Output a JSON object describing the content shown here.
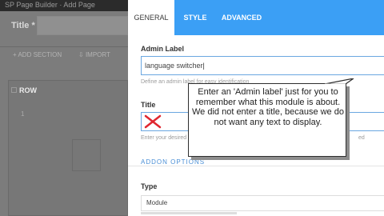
{
  "background": {
    "breadcrumb": "SP Page Builder · Add Page",
    "title_label": "Title *",
    "add_section_label": "ADD SECTION",
    "import_label": "IMPORT",
    "row_label": "ROW",
    "row_number": "1"
  },
  "modal": {
    "tabs": [
      {
        "label": "GENERAL",
        "active": true
      },
      {
        "label": "STYLE",
        "active": false
      },
      {
        "label": "ADVANCED",
        "active": false
      }
    ],
    "admin_label": {
      "label": "Admin Label",
      "value": "language switcher",
      "help": "Define an admin label for easy identification"
    },
    "title": {
      "label": "Title",
      "value": "",
      "help": "Enter your desired title for this module",
      "help_tail": "ed"
    },
    "section_title": "ADDON OPTIONS",
    "type": {
      "label": "Type",
      "value": "Module"
    }
  },
  "callout": {
    "text": "Enter an 'Admin label' just for you to remember what this module is about.  We did not enter a title, because we do not want any text to display."
  },
  "colors": {
    "tab_bar": "#3b9ff5",
    "section_title": "#4a8fd6",
    "cross_mark": "#e0262f"
  },
  "icons": {
    "cross": "red-x-icon",
    "chevron": "chevron-down-icon"
  }
}
